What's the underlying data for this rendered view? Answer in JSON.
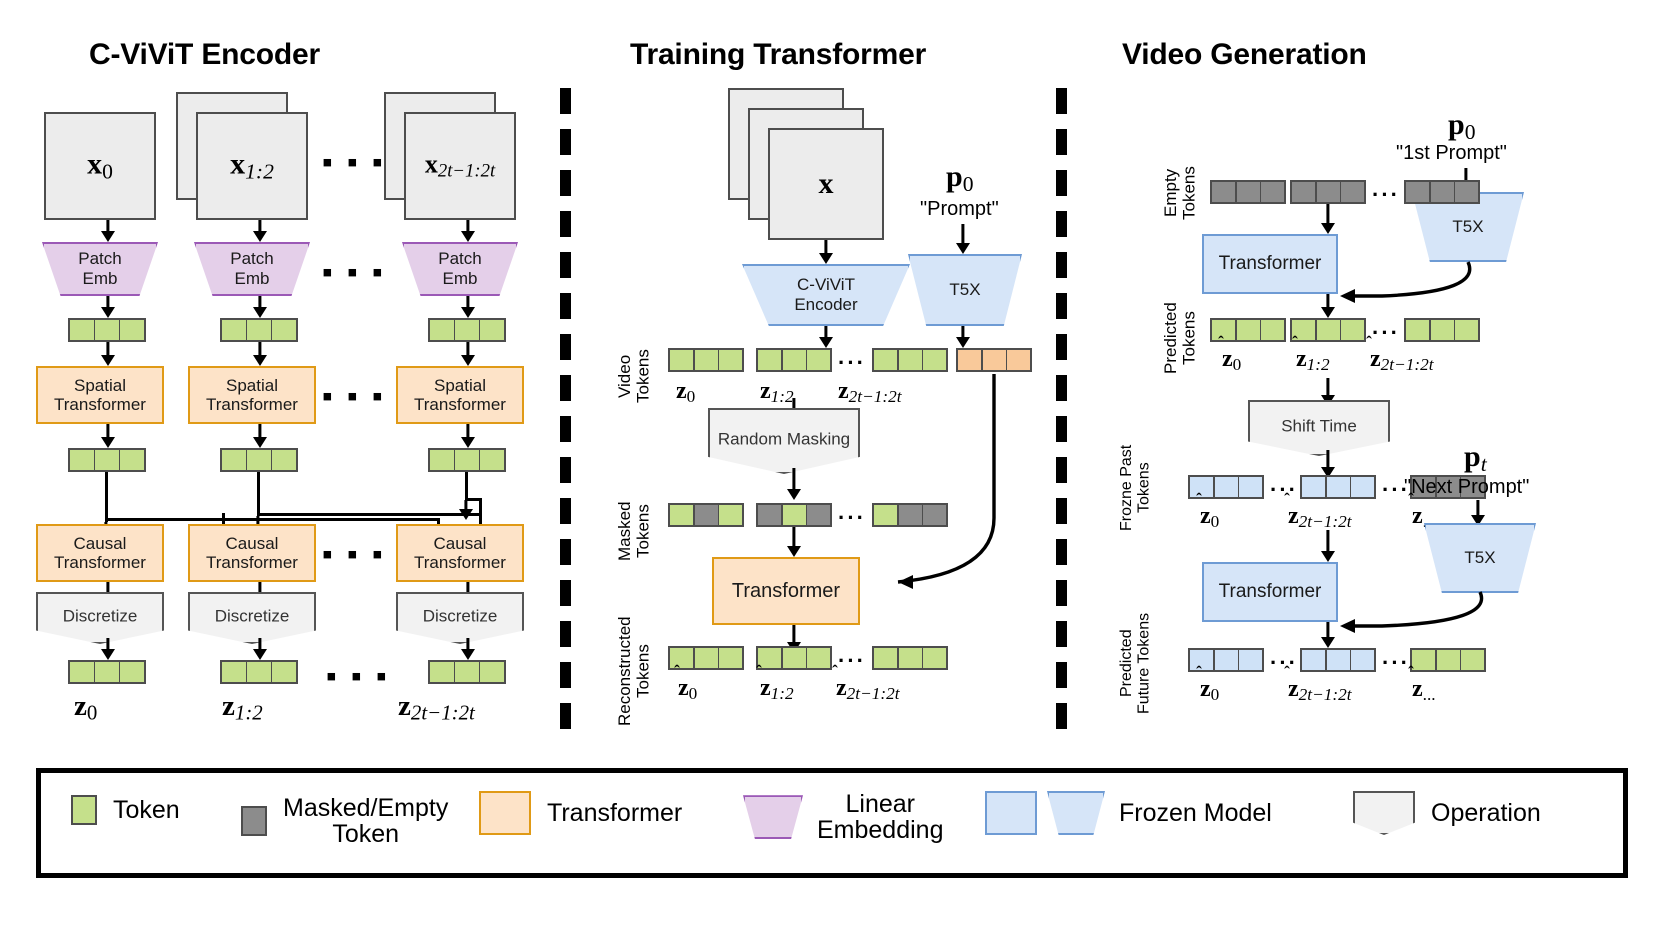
{
  "figure": {
    "panels": [
      {
        "title": "C-ViViT Encoder"
      },
      {
        "title": "Training Transformer"
      },
      {
        "title": "Video Generation"
      }
    ]
  },
  "encoder": {
    "title": "C-ViViT Encoder",
    "frames": [
      {
        "label_base": "x",
        "label_sub": "0"
      },
      {
        "label_base": "x",
        "label_sub": "1:2"
      },
      {
        "label_base": "x",
        "label_sub": "2t−1:2t"
      }
    ],
    "patch_emb_label": "Patch\nEmb",
    "spatial_label": "Spatial\nTransformer",
    "causal_label": "Causal\nTransformer",
    "discretize_label": "Discretize",
    "outputs": [
      {
        "label_base": "z",
        "label_sub": "0"
      },
      {
        "label_base": "z",
        "label_sub": "1:2"
      },
      {
        "label_base": "z",
        "label_sub": "2t−1:2t"
      }
    ],
    "ellipsis": "▪ ▪ ▪"
  },
  "training": {
    "title": "Training Transformer",
    "video_frame_label": "x",
    "cvivit_encoder_label": "C-ViViT\nEncoder",
    "t5x_label": "T5X",
    "prompt_symbol_base": "p",
    "prompt_symbol_sub": "0",
    "prompt_text": "\"Prompt\"",
    "row_labels": {
      "video_tokens": "Video\nTokens",
      "masked_tokens": "Masked\nTokens",
      "reconstructed_tokens": "Reconstructed\nTokens"
    },
    "random_masking_label": "Random Masking",
    "transformer_label": "Transformer",
    "video_token_labels": [
      {
        "base": "z",
        "sub": "0",
        "hat": false
      },
      {
        "base": "z",
        "sub": "1:2",
        "hat": false
      },
      {
        "base": "z",
        "sub": "2t−1:2t",
        "hat": false
      }
    ],
    "reconstructed_token_labels": [
      {
        "base": "z",
        "sub": "0",
        "hat": true
      },
      {
        "base": "z",
        "sub": "1:2",
        "hat": true
      },
      {
        "base": "z",
        "sub": "2t−1:2t",
        "hat": true
      }
    ],
    "ellipsis": "···"
  },
  "generation": {
    "title": "Video Generation",
    "stage1": {
      "prompt_symbol_base": "p",
      "prompt_symbol_sub": "0",
      "prompt_text": "\"1st Prompt\"",
      "t5x_label": "T5X",
      "transformer_label": "Transformer",
      "empty_tokens_label": "Empty\nTokens",
      "predicted_tokens_label": "Predicted\nTokens",
      "predicted_labels": [
        {
          "base": "z",
          "sub": "0",
          "hat": true
        },
        {
          "base": "z",
          "sub": "1:2",
          "hat": true
        },
        {
          "base": "z",
          "sub": "2t−1:2t",
          "hat": true
        }
      ]
    },
    "shift_time_label": "Shift Time",
    "stage2": {
      "prompt_symbol_base": "p",
      "prompt_symbol_sub": "t",
      "prompt_text": "\"Next Prompt\"",
      "t5x_label": "T5X",
      "transformer_label": "Transformer",
      "frozen_tokens_label": "Frozne Past\nTokens",
      "future_tokens_label": "Predicted\nFuture Tokens",
      "frozen_labels": [
        {
          "base": "z",
          "sub": "0",
          "hat": true
        },
        {
          "base": "z",
          "sub": "2t−1:2t",
          "hat": true
        },
        {
          "base": "z",
          "sub": "...",
          "hat": true
        }
      ],
      "future_labels": [
        {
          "base": "z",
          "sub": "0",
          "hat": true
        },
        {
          "base": "z",
          "sub": "2t−1:2t",
          "hat": true
        },
        {
          "base": "z",
          "sub": "...",
          "hat": true
        }
      ]
    },
    "ellipsis": "···"
  },
  "legend": {
    "items": [
      {
        "swatch": "token-green-swatch",
        "label": "Token"
      },
      {
        "swatch": "token-gray-swatch",
        "label": "Masked/Empty\nToken"
      },
      {
        "swatch": "transformer-orange-swatch",
        "label": "Transformer"
      },
      {
        "swatch": "linear-embedding-purple-trapezoid-swatch",
        "label": "Linear\nEmbedding"
      },
      {
        "swatch": "frozen-model-blue-swatch",
        "label": "Frozen Model"
      },
      {
        "swatch": "operation-chevron-swatch",
        "label": "Operation"
      }
    ]
  },
  "colors": {
    "token_green": "#c5e08b",
    "token_gray": "#8c8c8c",
    "token_orange": "#f9c99a",
    "token_blue": "#cfe2f7",
    "transformer_fill": "#fde3c8",
    "transformer_border": "#e09a16",
    "frozen_fill": "#d6e5f8",
    "frozen_border": "#6e9bd4",
    "embedding_fill": "#e4cfe9",
    "embedding_border": "#9b59b6",
    "operation_fill": "#f2f2f2",
    "operation_border": "#555555",
    "frame_fill": "#ececec",
    "frame_border": "#4d4d4d"
  }
}
